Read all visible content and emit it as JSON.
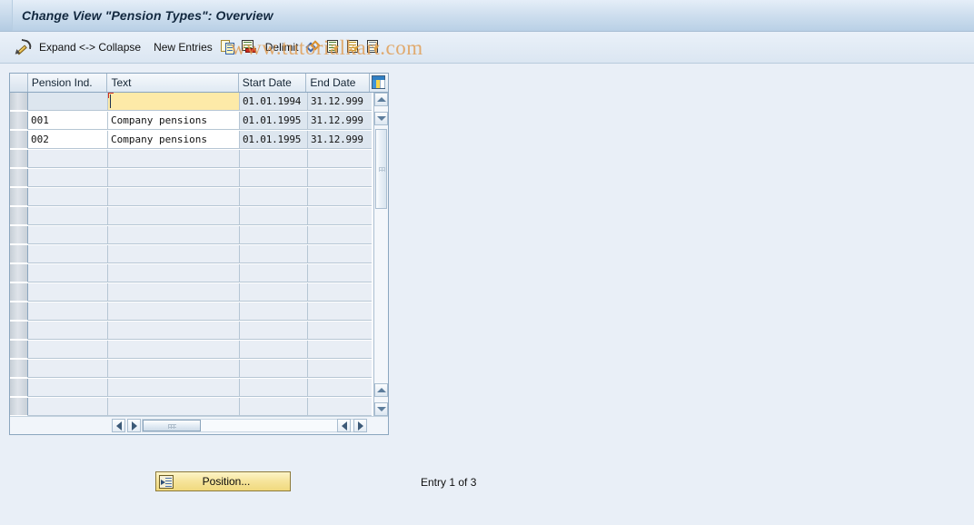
{
  "window": {
    "title": "Change View \"Pension Types\": Overview"
  },
  "toolbar": {
    "edit_icon": "pencil-icon",
    "items": [
      {
        "type": "icon",
        "name": "pencil-icon",
        "label": ""
      },
      {
        "type": "label",
        "name": "expand-collapse",
        "label": "Expand <-> Collapse"
      },
      {
        "type": "label",
        "name": "new-entries",
        "label": "New Entries"
      },
      {
        "type": "icon",
        "name": "copy-icon",
        "label": ""
      },
      {
        "type": "icon",
        "name": "delete-row-icon",
        "label": ""
      },
      {
        "type": "label",
        "name": "delimit",
        "label": "Delimit"
      },
      {
        "type": "icon",
        "name": "delimit-diamond-icon",
        "label": ""
      },
      {
        "type": "icon",
        "name": "select-detail-icon",
        "label": ""
      },
      {
        "type": "icon",
        "name": "previous-entry-icon",
        "label": ""
      },
      {
        "type": "icon",
        "name": "next-entry-icon",
        "label": ""
      }
    ],
    "expand_collapse_label": "Expand <-> Collapse",
    "new_entries_label": "New Entries",
    "delimit_label": "Delimit"
  },
  "watermark": {
    "text": "www.tutorialkart.com"
  },
  "table": {
    "settings_icon": "table-settings-icon",
    "columns": [
      {
        "key": "ind",
        "label": "Pension Ind."
      },
      {
        "key": "text",
        "label": "Text"
      },
      {
        "key": "sd",
        "label": "Start Date"
      },
      {
        "key": "ed",
        "label": "End Date"
      }
    ],
    "rows": [
      {
        "ind": "",
        "text": "",
        "sd": "01.01.1994",
        "ed": "31.12.999",
        "state": "editing"
      },
      {
        "ind": "001",
        "text": "Company pensions",
        "sd": "01.01.1995",
        "ed": "31.12.999",
        "state": "filled"
      },
      {
        "ind": "002",
        "text": "Company pensions",
        "sd": "01.01.1995",
        "ed": "31.12.999",
        "state": "filled"
      }
    ],
    "empty_row_count": 15
  },
  "footer": {
    "position_button_label": "Position...",
    "entry_count_label": "Entry 1 of 3"
  },
  "colors": {
    "title_bar": "#c3d7ea",
    "page_background": "#e9eff7",
    "focused_cell": "#fdeaa8",
    "button_yellow": "#f6e49a",
    "watermark": "#e09a4d"
  }
}
